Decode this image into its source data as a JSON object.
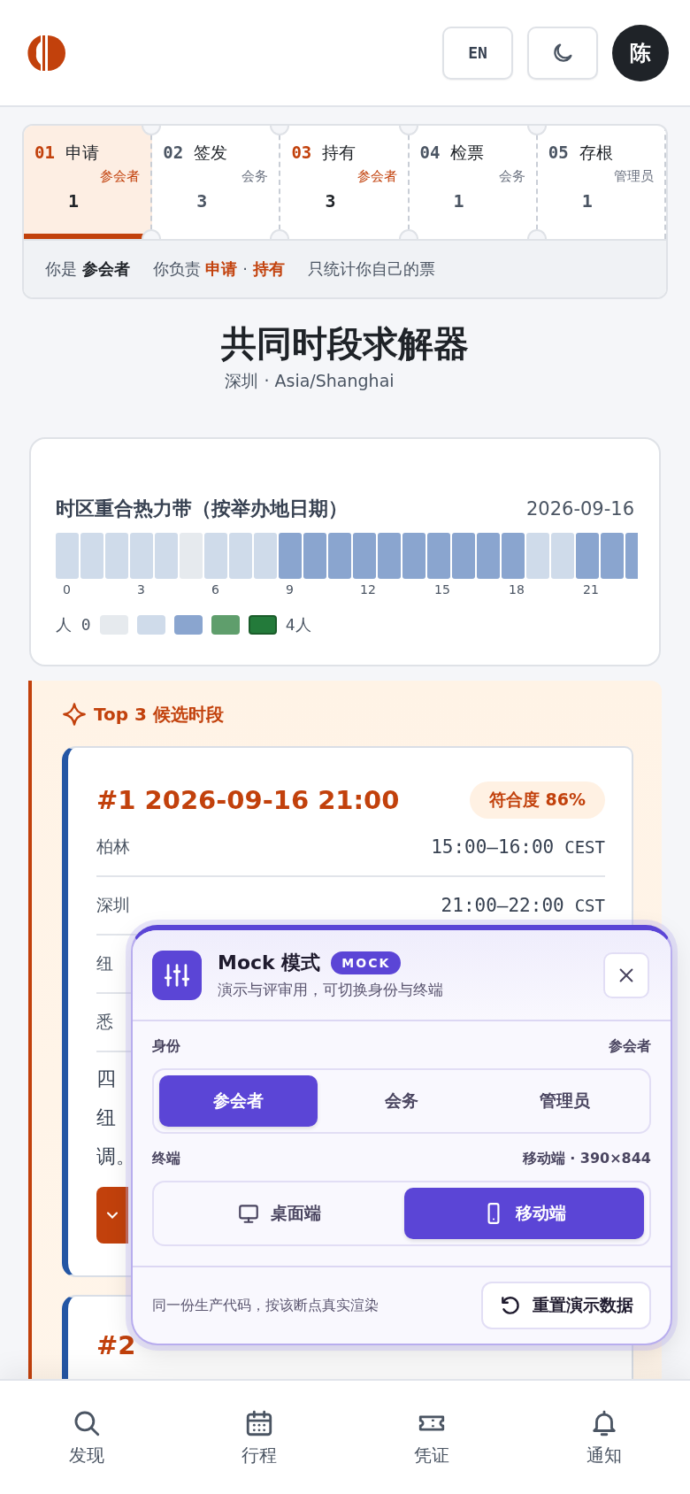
{
  "header": {
    "lang_button": "EN",
    "avatar": "陈"
  },
  "stepper": {
    "steps": [
      {
        "number": "01",
        "name": "申请",
        "role": "参会者",
        "count": "1",
        "mine": true,
        "selected": true
      },
      {
        "number": "02",
        "name": "签发",
        "role": "会务",
        "count": "3",
        "mine": false,
        "selected": false
      },
      {
        "number": "03",
        "name": "持有",
        "role": "参会者",
        "count": "3",
        "mine": true,
        "selected": false
      },
      {
        "number": "04",
        "name": "检票",
        "role": "会务",
        "count": "1",
        "mine": false,
        "selected": false
      },
      {
        "number": "05",
        "name": "存根",
        "role": "管理员",
        "count": "1",
        "mine": false,
        "selected": false
      }
    ],
    "role_note": "你是 **参会者**",
    "duty_note": "你负责 **申请** · **持有**",
    "scope_note": "只统计你自己的票"
  },
  "page": {
    "title": "共同时段求解器",
    "subtitle": "深圳 · Asia/Shanghai"
  },
  "heatmap": {
    "title": "时区重合热力带（按举办地日期）",
    "date": "2026-09-16",
    "cells": [
      {
        "color": "#cfdbea"
      },
      {
        "color": "#cfdbea"
      },
      {
        "color": "#cfdbea"
      },
      {
        "color": "#cfdbea"
      },
      {
        "color": "#cfdbea"
      },
      {
        "color": "#e6eaee"
      },
      {
        "color": "#cfdbea"
      },
      {
        "color": "#cfdbea"
      },
      {
        "color": "#cfdbea"
      },
      {
        "color": "#8aa5cf"
      },
      {
        "color": "#8aa5cf"
      },
      {
        "color": "#8aa5cf"
      },
      {
        "color": "#8aa5cf"
      },
      {
        "color": "#8aa5cf"
      },
      {
        "color": "#8aa5cf"
      },
      {
        "color": "#8aa5cf"
      },
      {
        "color": "#8aa5cf"
      },
      {
        "color": "#8aa5cf"
      },
      {
        "color": "#8aa5cf"
      },
      {
        "color": "#cfdbea"
      },
      {
        "color": "#cfdbea"
      },
      {
        "color": "#8aa5cf"
      },
      {
        "color": "#8aa5cf"
      },
      {
        "color": "#8aa5cf"
      }
    ],
    "ticks": [
      "0",
      "3",
      "6",
      "9",
      "12",
      "15",
      "18",
      "21"
    ],
    "legend": {
      "min_label": "人 0",
      "max_label": "4人",
      "swatches": [
        {
          "color": "#e6eaee"
        },
        {
          "color": "#cfdbea"
        },
        {
          "color": "#8aa5cf"
        },
        {
          "color": "#5f9e6c"
        },
        {
          "color": "#237a3a"
        }
      ]
    }
  },
  "candidates": {
    "heading": "Top 3 候选时段",
    "items": [
      {
        "title": "#1 2026-09-16 21:00",
        "score": "符合度 86%",
        "rows": [
          {
            "city": "柏林",
            "time": "15:00–16:00",
            "zone": "CEST"
          },
          {
            "city": "深圳",
            "time": "21:00–22:00",
            "zone": "CST"
          },
          {
            "city": "纽"
          },
          {
            "city": "悉"
          }
        ],
        "note_lines": [
          "四",
          "纽",
          "调。"
        ]
      },
      {
        "title": "#2"
      }
    ]
  },
  "mock": {
    "title": "Mock 模式",
    "badge": "MOCK",
    "subtitle": "演示与评审用，可切换身份与终端",
    "identity": {
      "label": "身份",
      "value": "参会者",
      "options": [
        {
          "label": "参会者",
          "selected": true
        },
        {
          "label": "会务",
          "selected": false
        },
        {
          "label": "管理员",
          "selected": false
        }
      ]
    },
    "device": {
      "label": "终端",
      "value": "移动端 · 390×844",
      "options": [
        {
          "label": "桌面端",
          "kind": "desktop",
          "selected": false
        },
        {
          "label": "移动端",
          "kind": "mobile",
          "selected": true
        }
      ]
    },
    "footer_note": "同一份生产代码，按该断点真实渲染",
    "reset_button": "重置演示数据"
  },
  "nav": {
    "items": [
      {
        "label": "发现",
        "kind": "search"
      },
      {
        "label": "行程",
        "kind": "calendar"
      },
      {
        "label": "凭证",
        "kind": "ticket"
      },
      {
        "label": "通知",
        "kind": "bell"
      }
    ]
  }
}
